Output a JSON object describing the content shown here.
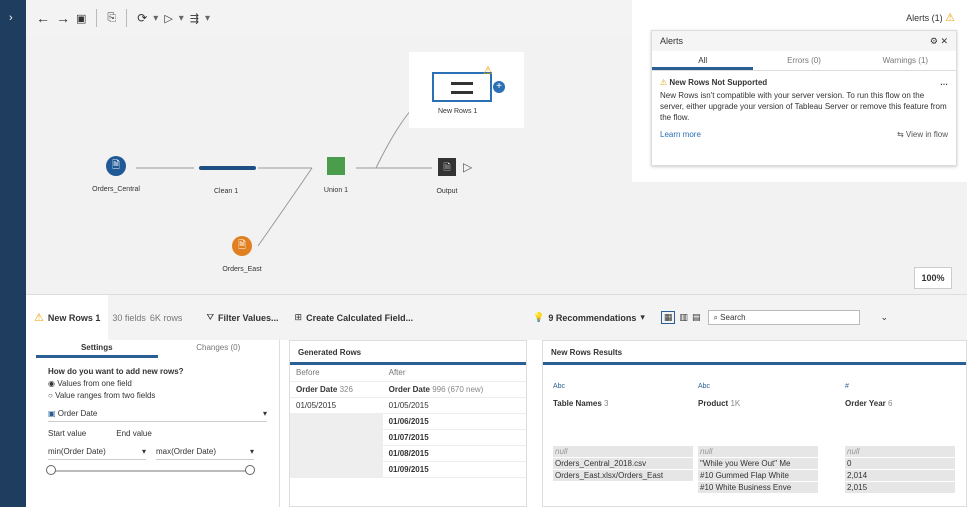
{
  "toolbar": {
    "icons": [
      "back",
      "forward",
      "save",
      "page",
      "refresh",
      "run",
      "add-step"
    ]
  },
  "alerts": {
    "button": "Alerts (1)",
    "title": "Alerts",
    "tabs": [
      "All",
      "Errors (0)",
      "Warnings (1)"
    ],
    "warning_title": "New Rows Not Supported",
    "warning_text": "New Rows isn't compatible with your server version. To run this flow on the server, either upgrade your version of Tableau Server or remove this feature from the flow.",
    "learn_more": "Learn more",
    "view_in_flow": "View in flow"
  },
  "flow": {
    "orders_central": "Orders_Central",
    "clean": "Clean 1",
    "union": "Union 1",
    "output": "Output",
    "orders_east": "Orders_East",
    "new_rows": "New Rows 1",
    "zoom": "100%"
  },
  "bar": {
    "step": "New Rows 1",
    "fields": "30 fields",
    "rows": "6K rows",
    "filter": "Filter Values...",
    "calc": "Create Calculated Field...",
    "recs": "9 Recommendations",
    "search": "Search"
  },
  "settings": {
    "tab1": "Settings",
    "tab2": "Changes (0)",
    "question": "How do you want to add new rows?",
    "opt1": "Values from one field",
    "opt2": "Value ranges from two fields",
    "field": "Order Date",
    "start_label": "Start value",
    "end_label": "End value",
    "start": "min(Order Date)",
    "end": "max(Order Date)"
  },
  "generated": {
    "title": "Generated Rows",
    "before": "Before",
    "after": "After",
    "col1": "Order Date",
    "col1n": "326",
    "col2": "Order Date",
    "col2n": "996 (670 new)",
    "rows": [
      [
        "01/05/2015",
        "01/05/2015"
      ],
      [
        "",
        "01/06/2015"
      ],
      [
        "",
        "01/07/2015"
      ],
      [
        "",
        "01/08/2015"
      ],
      [
        "",
        "01/09/2015"
      ]
    ]
  },
  "results": {
    "title": "New Rows Results",
    "cols": [
      {
        "type": "Abc",
        "name": "Table Names",
        "count": "3",
        "vals": [
          "null",
          "Orders_Central_2018.csv",
          "Orders_East.xlsx/Orders_East"
        ]
      },
      {
        "type": "Abc",
        "name": "Product",
        "count": "1K",
        "vals": [
          "null",
          "\"While you Were Out\" Me",
          "#10 Gummed Flap White",
          "#10 White Business Enve"
        ]
      },
      {
        "type": "#",
        "name": "Order Year",
        "count": "6",
        "vals": [
          "null",
          "0",
          "2,014",
          "2,015"
        ]
      }
    ]
  }
}
